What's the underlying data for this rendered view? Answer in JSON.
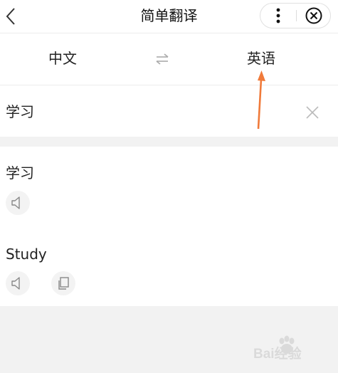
{
  "header": {
    "title": "简单翻译",
    "back_icon": "chevron-left-icon",
    "more_icon": "more-vertical-icon",
    "close_icon": "close-circle-icon"
  },
  "language": {
    "source": "中文",
    "target": "英语",
    "swap_icon": "swap-arrows-icon",
    "annotation_color": "#f07a3a"
  },
  "input": {
    "value": "学习",
    "clear_icon": "close-icon"
  },
  "result": {
    "source_text": "学习",
    "translation": "Study",
    "speaker_icon": "speaker-icon",
    "copy_icon": "copy-icon"
  },
  "watermark": {
    "text": "Bai经验"
  }
}
